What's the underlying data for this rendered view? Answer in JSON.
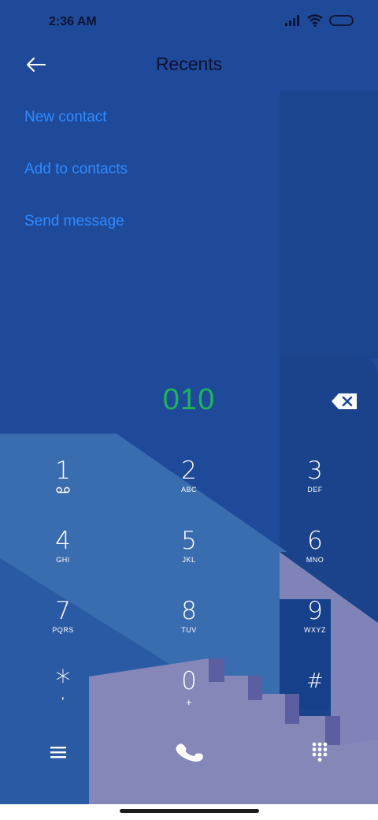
{
  "status_bar": {
    "time": "2:36 AM",
    "icons": [
      "signal-icon",
      "wifi-icon",
      "battery-icon"
    ]
  },
  "header": {
    "title": "Recents",
    "back_icon": "arrow-left-icon"
  },
  "actions": [
    {
      "label": "New contact"
    },
    {
      "label": "Add to contacts"
    },
    {
      "label": "Send message"
    }
  ],
  "dial": {
    "number": "010",
    "number_color": "#1fb35a",
    "backspace_icon": "backspace-icon"
  },
  "keypad": [
    {
      "digit": "1",
      "letters": "",
      "icon": "voicemail-icon"
    },
    {
      "digit": "2",
      "letters": "ABC"
    },
    {
      "digit": "3",
      "letters": "DEF"
    },
    {
      "digit": "4",
      "letters": "GHI"
    },
    {
      "digit": "5",
      "letters": "JKL"
    },
    {
      "digit": "6",
      "letters": "MNO"
    },
    {
      "digit": "7",
      "letters": "PQRS"
    },
    {
      "digit": "8",
      "letters": "TUV"
    },
    {
      "digit": "9",
      "letters": "WXYZ"
    },
    {
      "digit": "*",
      "letters": ","
    },
    {
      "digit": "0",
      "letters": "+"
    },
    {
      "digit": "#",
      "letters": ""
    }
  ],
  "bottom_bar": {
    "menu_icon": "menu-icon",
    "call_icon": "phone-icon",
    "dialpad_icon": "dialpad-icon"
  },
  "colors": {
    "accent": "#2f8bff",
    "background": "#1f4a9a"
  }
}
